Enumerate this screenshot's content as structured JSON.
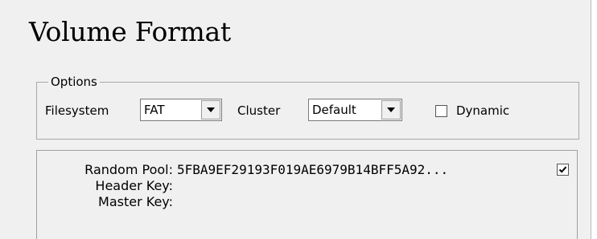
{
  "title": "Volume Format",
  "options": {
    "legend": "Options",
    "filesystem_label": "Filesystem",
    "filesystem_value": "FAT",
    "cluster_label": "Cluster",
    "cluster_value": "Default",
    "dynamic_label": "Dynamic",
    "dynamic_checked": false
  },
  "keys": {
    "random_pool_label": "Random Pool:",
    "random_pool_value": "5FBA9EF29193F019AE6979B14BFF5A92...",
    "random_pool_checked": true,
    "header_key_label": "Header Key:",
    "header_key_value": "",
    "master_key_label": "Master Key:",
    "master_key_value": ""
  },
  "icons": {
    "dropdown": "chevron-down-icon",
    "check": "checkmark-icon"
  }
}
